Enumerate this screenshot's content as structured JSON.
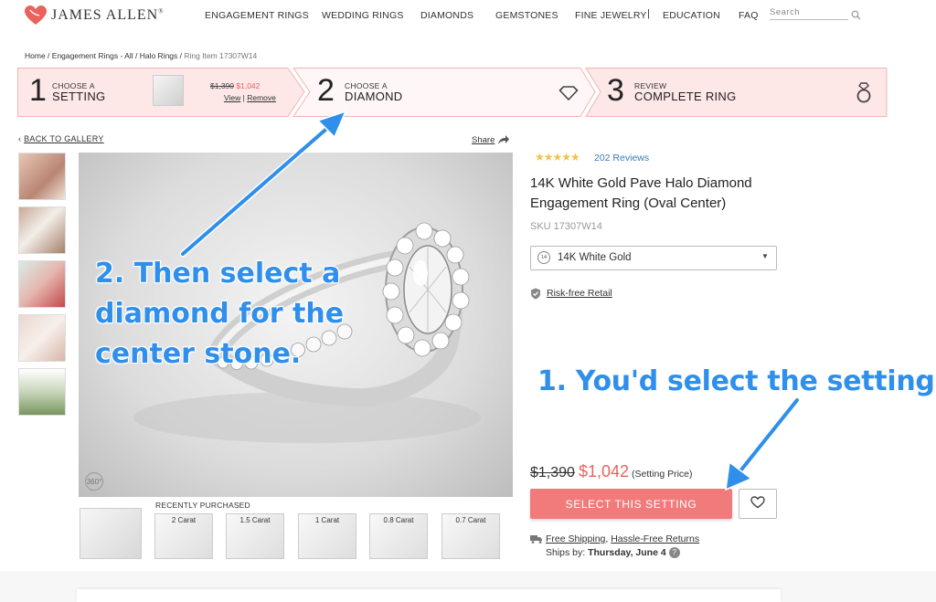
{
  "header": {
    "brand": "JAMES ALLEN",
    "brand_mark": "®",
    "nav": [
      "ENGAGEMENT RINGS",
      "WEDDING RINGS",
      "DIAMONDS",
      "GEMSTONES",
      "FINE JEWELRY",
      "EDUCATION",
      "FAQ"
    ],
    "nav_separator": "|",
    "search_placeholder": "Search"
  },
  "breadcrumb": {
    "items": [
      "Home",
      "Engagement Rings - All",
      "Halo Rings"
    ],
    "separator": " / ",
    "current": "Ring Item 17307W14"
  },
  "steps": [
    {
      "number": "1",
      "small": "CHOOSE A",
      "big": "SETTING",
      "price_old": "$1,390",
      "price_new": "$1,042",
      "link_view": "View",
      "link_sep": " | ",
      "link_remove": "Remove"
    },
    {
      "number": "2",
      "small": "CHOOSE A",
      "big": "DIAMOND",
      "icon": "diamond-icon"
    },
    {
      "number": "3",
      "small": "REVIEW",
      "big": "COMPLETE RING",
      "icon": "ring-icon"
    }
  ],
  "gallery": {
    "back_label": "BACK TO GALLERY",
    "back_arrow": "‹",
    "share_label": "Share",
    "badge_360": "360°"
  },
  "recently_purchased": {
    "title": "RECENTLY PURCHASED",
    "prev_arrow": "‹",
    "items": [
      "2 Carat",
      "1.5 Carat",
      "1 Carat",
      "0.8 Carat",
      "0.7 Carat"
    ]
  },
  "product": {
    "stars": "★★★★★",
    "rating": 5,
    "reviews": "202 Reviews",
    "title": "14K White Gold Pave Halo Diamond Engagement Ring (Oval Center)",
    "sku": "SKU 17307W14",
    "metal_badge": "14",
    "metal": "14K White Gold",
    "metal_caret": "▼",
    "risk_free": "Risk-free Retail",
    "price_old": "$1,390",
    "price_new": "$1,042",
    "price_tag": "(Setting Price)",
    "cta": "SELECT THIS SETTING",
    "shipping_link_1": "Free Shipping",
    "shipping_sep": ", ",
    "shipping_link_2": "Hassle-Free Returns",
    "ships_by_label": "Ships by: ",
    "ships_by_date": "Thursday, June 4",
    "help_glyph": "?"
  },
  "annotations": {
    "step2": "2. Then select a diamond for the center stone.",
    "step1": "1. You'd select the setting."
  },
  "colors": {
    "accent": "#f07b7a",
    "price_sale": "#e8625e",
    "steps_bg": "#fde7e7",
    "steps_active_bg": "#fff7f7",
    "annotation": "#2f8fea",
    "link_blue": "#3a7ab8",
    "star": "#f2c24b"
  }
}
